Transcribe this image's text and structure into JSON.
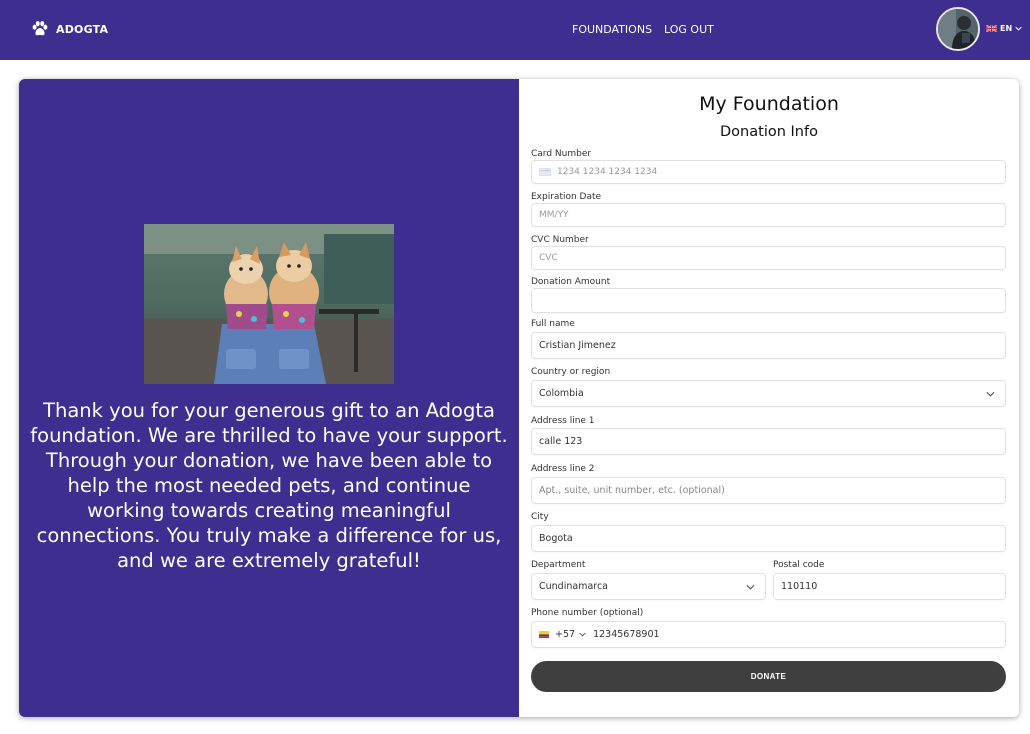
{
  "header": {
    "brand": "ADOGTA",
    "nav": {
      "foundations": "FOUNDATIONS",
      "logout": "LOG OUT"
    },
    "language": "EN",
    "colors": {
      "primary": "#3d2e8f"
    }
  },
  "left": {
    "message": "Thank you for your generous gift to an Adogta foundation. We are thrilled to have your support. Through your donation, we have been able to help the most needed pets, and continue working towards creating meaningful connections. You truly make a difference for us, and we are extremely grateful!"
  },
  "form": {
    "title": "My Foundation",
    "subtitle": "Donation Info",
    "card_number": {
      "label": "Card Number",
      "placeholder": "1234 1234 1234 1234"
    },
    "expiration": {
      "label": "Expiration Date",
      "placeholder": "MM/YY"
    },
    "cvc": {
      "label": "CVC Number",
      "placeholder": "CVC"
    },
    "amount": {
      "label": "Donation Amount",
      "value": ""
    },
    "full_name": {
      "label": "Full name",
      "value": "Cristian Jimenez"
    },
    "country": {
      "label": "Country or region",
      "value": "Colombia"
    },
    "address1": {
      "label": "Address line 1",
      "value": "calle 123"
    },
    "address2": {
      "label": "Address line 2",
      "placeholder": "Apt., suite, unit number, etc. (optional)"
    },
    "city": {
      "label": "City",
      "value": "Bogota"
    },
    "department": {
      "label": "Department",
      "value": "Cundinamarca"
    },
    "postal": {
      "label": "Postal code",
      "value": "110110"
    },
    "phone": {
      "label": "Phone number (optional)",
      "code": "+57",
      "value": "12345678901"
    },
    "donate": "DONATE"
  }
}
